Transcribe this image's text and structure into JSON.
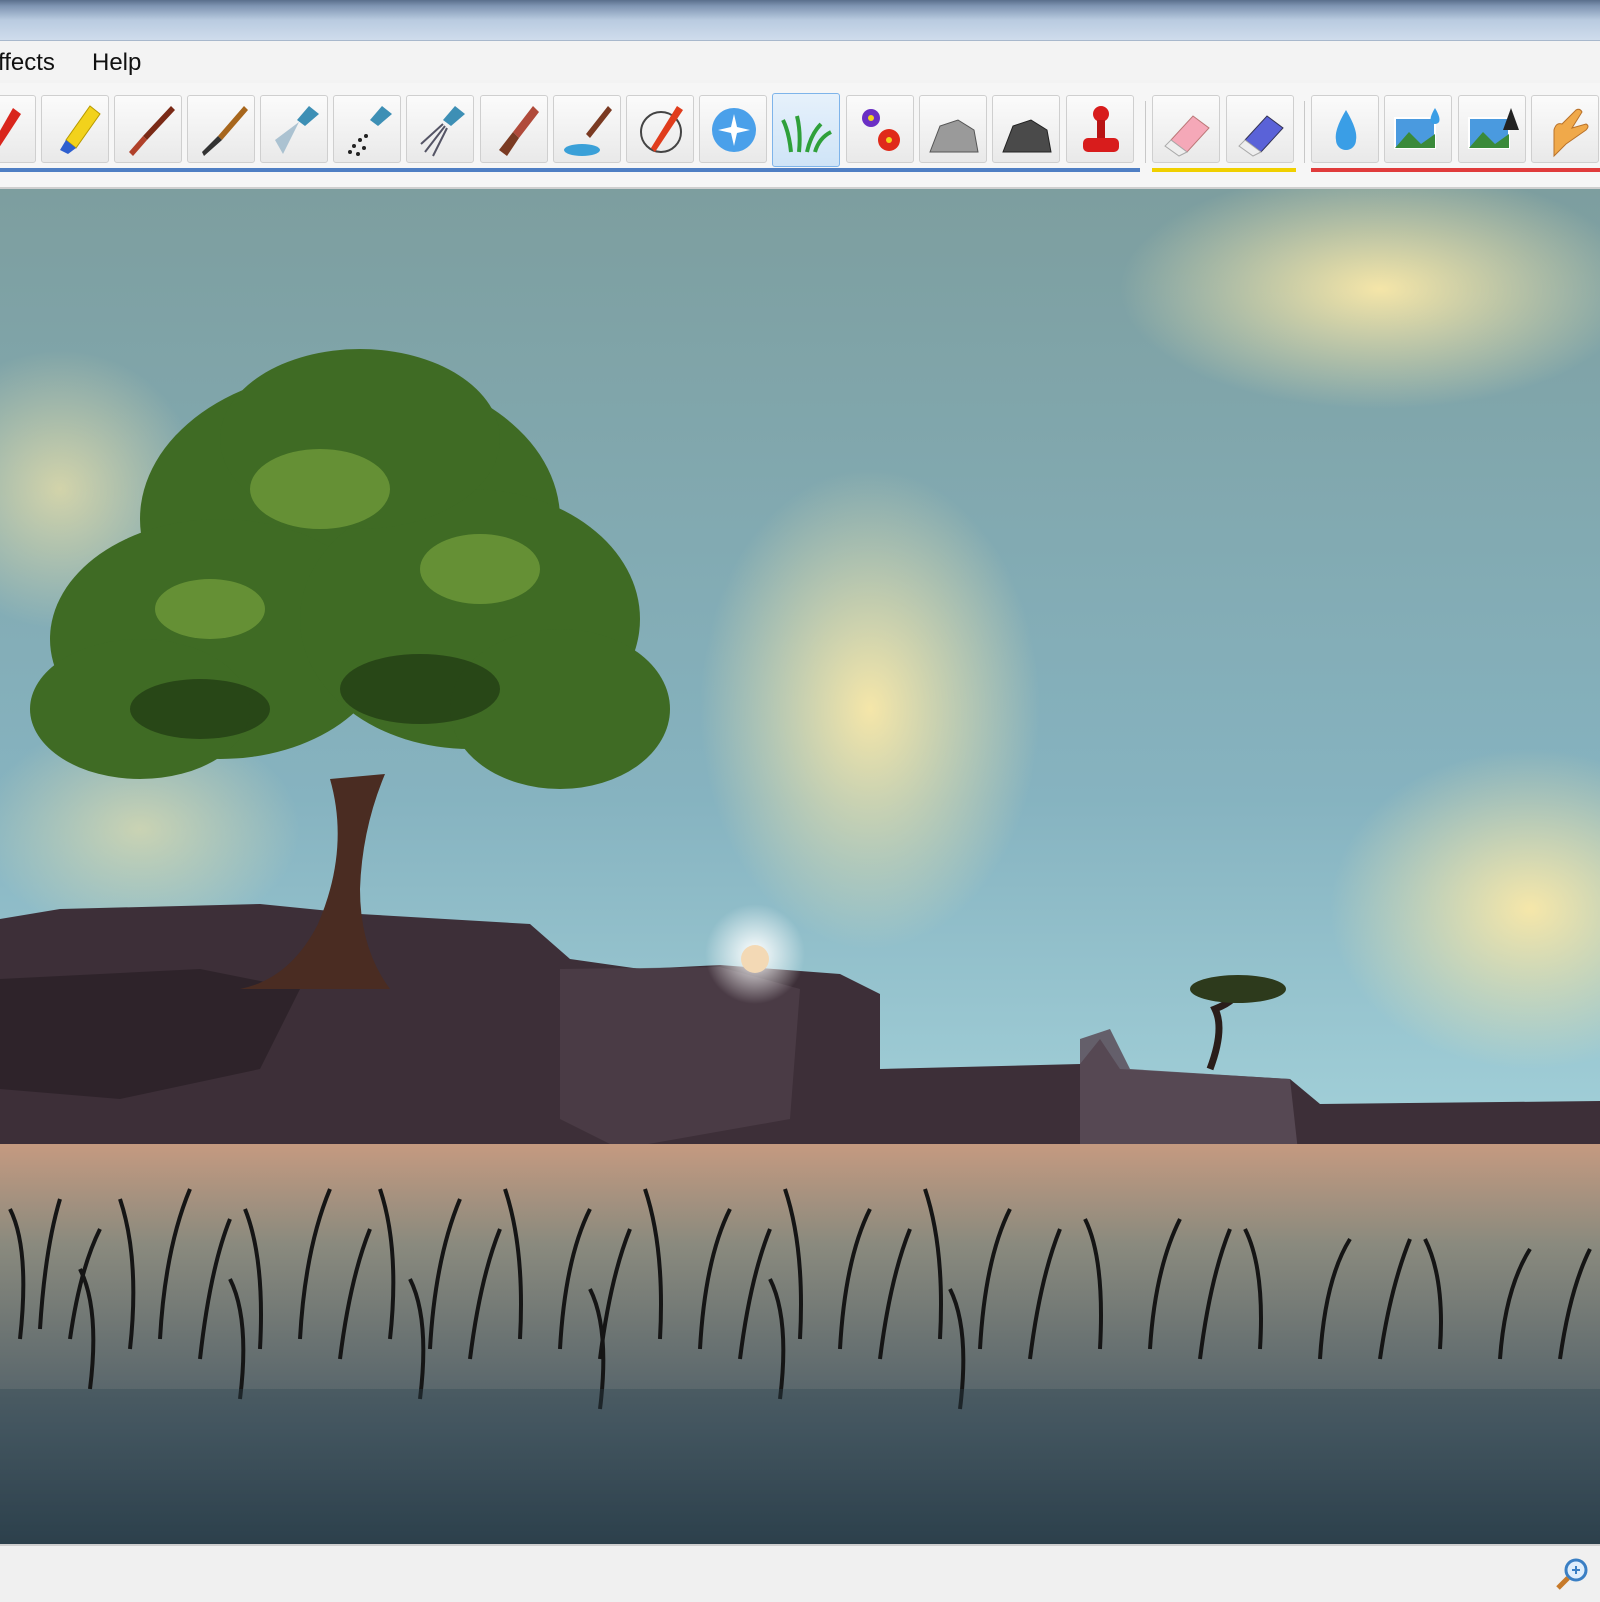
{
  "menu": {
    "items": [
      {
        "label": "ffects"
      },
      {
        "label": "Help"
      }
    ]
  },
  "toolbar": {
    "tools": [
      {
        "name": "pencil-icon"
      },
      {
        "name": "crayon-icon"
      },
      {
        "name": "oil-brush-icon"
      },
      {
        "name": "watercolor-brush-icon"
      },
      {
        "name": "airbrush-icon"
      },
      {
        "name": "spray-dots-icon"
      },
      {
        "name": "spray-lines-icon"
      },
      {
        "name": "flat-brush-icon"
      },
      {
        "name": "paint-bucket-brush-icon"
      },
      {
        "name": "ink-pen-icon"
      },
      {
        "name": "sparkle-brush-icon"
      },
      {
        "name": "grass-brush-icon",
        "selected": true
      },
      {
        "name": "flowers-brush-icon"
      },
      {
        "name": "pattern-light-icon"
      },
      {
        "name": "pattern-dark-icon"
      },
      {
        "name": "stamp-icon"
      },
      {
        "name": "eraser-pink-icon"
      },
      {
        "name": "eraser-blue-icon"
      },
      {
        "name": "water-drop-icon"
      },
      {
        "name": "image-blur-icon"
      },
      {
        "name": "image-sharpen-icon"
      },
      {
        "name": "smudge-hand-icon"
      }
    ],
    "group_colors": {
      "brushes": "#4f7fc4",
      "erasers": "#f0d000",
      "effects": "#e03c3c"
    }
  },
  "canvas": {
    "scene": "painting",
    "colors": {
      "sky": "#7fa6ad",
      "cloud": "#f5e2a0",
      "rock": "#4a3c44",
      "field": "#b8907a",
      "grass": "#151515",
      "foliage": "#3f6b24"
    }
  },
  "status": {
    "zoom_icon": "zoom-in-icon"
  }
}
